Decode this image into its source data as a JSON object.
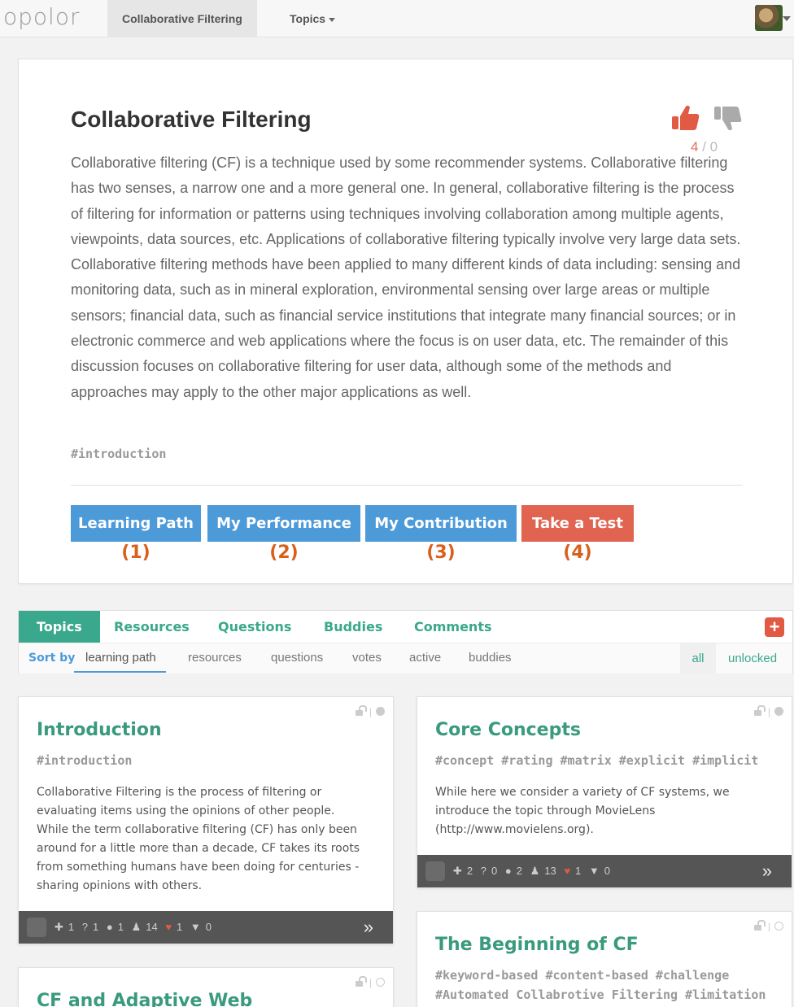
{
  "nav": {
    "logo": "opolor",
    "tab_active": "Collaborative Filtering",
    "tab_topics": "Topics"
  },
  "main": {
    "title": "Collaborative Filtering",
    "votes_up": "4",
    "votes_sep": "/",
    "votes_down": "0",
    "description": "Collaborative filtering (CF) is a technique used by some recommender systems. Collaborative filtering has two senses, a narrow one and a more general one. In general, collaborative filtering is the process of filtering for information or patterns using techniques involving collaboration among multiple agents, viewpoints, data sources, etc. Applications of collaborative filtering typically involve very large data sets. Collaborative filtering methods have been applied to many different kinds of data including: sensing and monitoring data, such as in mineral exploration, environmental sensing over large areas or multiple sensors; financial data, such as financial service institutions that integrate many financial sources; or in electronic commerce and web applications where the focus is on user data, etc. The remainder of this discussion focuses on collaborative filtering for user data, although some of the methods and approaches may apply to the other major applications as well.",
    "tag": "#introduction",
    "buttons": [
      {
        "label": "Learning Path",
        "num": "(1)"
      },
      {
        "label": "My Performance",
        "num": "(2)"
      },
      {
        "label": "My Contribution",
        "num": "(3)"
      },
      {
        "label": "Take a Test",
        "num": "(4)"
      }
    ]
  },
  "tabs": {
    "items": [
      "Topics",
      "Resources",
      "Questions",
      "Buddies",
      "Comments"
    ],
    "add": "+"
  },
  "sort": {
    "label": "Sort by",
    "options": [
      "learning path",
      "resources",
      "questions",
      "votes",
      "active",
      "buddies"
    ],
    "filter_all": "all",
    "filter_unlocked": "unlocked"
  },
  "cards": [
    {
      "title": "Introduction",
      "tags": "#introduction",
      "body": [
        "Collaborative Filtering is the process of filtering or",
        "evaluating items using the opinions of other people.",
        "While the term collaborative filtering (CF) has only been",
        "around for a little more than a decade, CF takes its roots",
        "from something humans have been doing for centuries -",
        "sharing opinions with others."
      ],
      "stats": {
        "puzzle": "1",
        "question": "1",
        "comment": "1",
        "people": "14",
        "like": "1",
        "dislike": "0"
      },
      "more": "»"
    },
    {
      "title": "Core Concepts",
      "tags": "#concept  #rating  #matrix  #explicit  #implicit",
      "body": [
        "While here we consider a variety of CF systems, we",
        "introduce the topic through MovieLens",
        "(http://www.movielens.org)."
      ],
      "stats": {
        "puzzle": "2",
        "question": "0",
        "comment": "2",
        "people": "13",
        "like": "1",
        "dislike": "0"
      },
      "more": "»"
    },
    {
      "title": "The Beginning of CF",
      "tags1": "#keyword-based  #content-based  #challenge",
      "tags2": "#Automated Collabrotive Filtering  #limitation"
    },
    {
      "title": "CF and Adaptive Web"
    }
  ],
  "colors": {
    "accent_green": "#3aa88c",
    "accent_blue": "#4d9ad9",
    "accent_red": "#e06450",
    "number_orange": "#d9601c"
  }
}
